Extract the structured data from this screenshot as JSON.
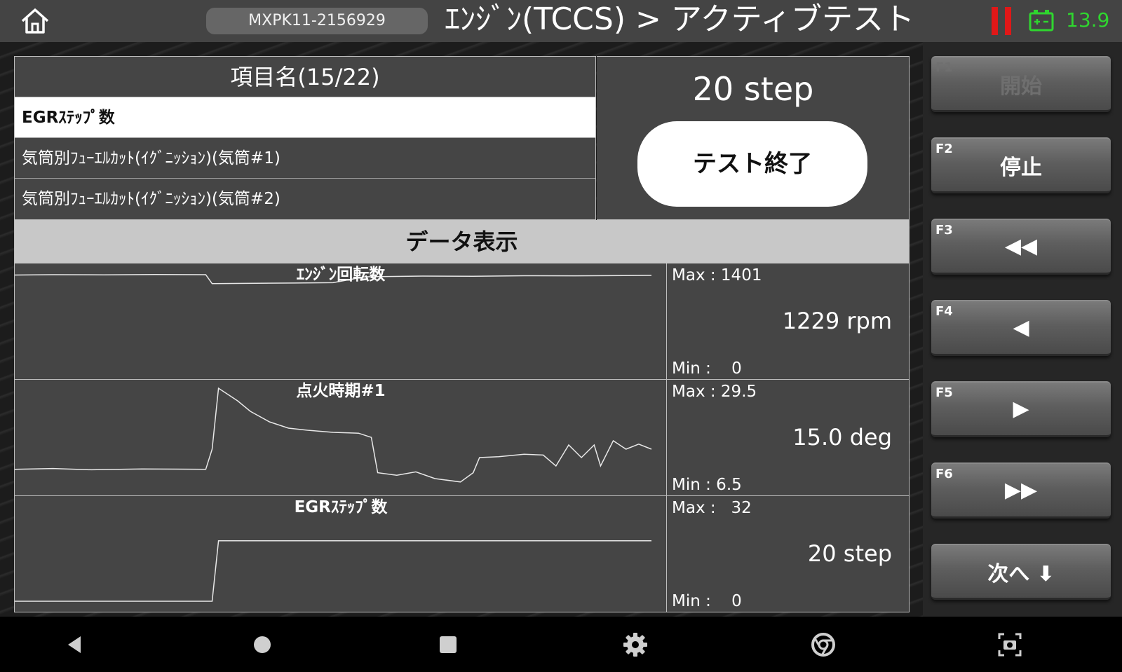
{
  "header": {
    "home_icon": "home-icon",
    "vehicle_id": "MXPK11-2156929",
    "title": "ｴﾝｼﾞﾝ(TCCS) > アクティブテスト",
    "status_icon": "pause-indicator-icon",
    "battery_icon": "battery-icon",
    "voltage": "13.9",
    "colors": {
      "status": "#e01818",
      "battery": "#2fd62f"
    }
  },
  "items": {
    "header": "項目名(15/22)",
    "rows": [
      {
        "label": "EGRｽﾃｯﾌﾟ数",
        "selected": true
      },
      {
        "label": "気筒別ﾌｭｰｴﾙｶｯﾄ(ｲｸﾞﾆｯｼｮﾝ)(気筒#1)",
        "selected": false
      },
      {
        "label": "気筒別ﾌｭｰｴﾙｶｯﾄ(ｲｸﾞﾆｯｼｮﾝ)(気筒#2)",
        "selected": false
      }
    ]
  },
  "test": {
    "current_value": "20 step",
    "end_button": "テスト終了"
  },
  "data_header": "データ表示",
  "graphs": [
    {
      "name": "ｴﾝｼﾞﾝ回転数",
      "max": "Max : 1401",
      "min": "Min :    0",
      "current": "1229 rpm",
      "y_range": [
        0,
        1401
      ],
      "trace": [
        [
          0,
          1355
        ],
        [
          0.06,
          1360
        ],
        [
          0.14,
          1358
        ],
        [
          0.22,
          1362
        ],
        [
          0.3,
          1360
        ],
        [
          0.31,
          1230
        ],
        [
          0.36,
          1235
        ],
        [
          0.44,
          1240
        ],
        [
          0.5,
          1245
        ],
        [
          0.55,
          1330
        ],
        [
          0.64,
          1340
        ],
        [
          0.72,
          1338
        ],
        [
          0.8,
          1345
        ],
        [
          0.88,
          1344
        ],
        [
          1.0,
          1350
        ]
      ]
    },
    {
      "name": "点火時期#1",
      "max": "Max : 29.5",
      "min": "Min : 6.5",
      "current": "15.0 deg",
      "y_range": [
        6.5,
        29.5
      ],
      "trace": [
        [
          0,
          10.2
        ],
        [
          0.06,
          10.4
        ],
        [
          0.12,
          10.1
        ],
        [
          0.2,
          10.3
        ],
        [
          0.3,
          10.2
        ],
        [
          0.31,
          15
        ],
        [
          0.32,
          29.5
        ],
        [
          0.35,
          26.5
        ],
        [
          0.37,
          24
        ],
        [
          0.4,
          21.5
        ],
        [
          0.43,
          20
        ],
        [
          0.46,
          19.5
        ],
        [
          0.5,
          19
        ],
        [
          0.54,
          18.8
        ],
        [
          0.56,
          17.8
        ],
        [
          0.57,
          9.4
        ],
        [
          0.6,
          8.8
        ],
        [
          0.63,
          9.6
        ],
        [
          0.66,
          8.0
        ],
        [
          0.7,
          7.2
        ],
        [
          0.72,
          9.4
        ],
        [
          0.73,
          13
        ],
        [
          0.76,
          13.2
        ],
        [
          0.8,
          13.8
        ],
        [
          0.83,
          13.6
        ],
        [
          0.85,
          11
        ],
        [
          0.87,
          16
        ],
        [
          0.89,
          13
        ],
        [
          0.91,
          16
        ],
        [
          0.92,
          11
        ],
        [
          0.94,
          17
        ],
        [
          0.96,
          15
        ],
        [
          0.98,
          16.2
        ],
        [
          1.0,
          15
        ]
      ]
    },
    {
      "name": "EGRｽﾃｯﾌﾟ数",
      "max": "Max :   32",
      "min": "Min :    0",
      "current": "20 step",
      "y_range": [
        0,
        32
      ],
      "trace": [
        [
          0,
          0
        ],
        [
          0.31,
          0
        ],
        [
          0.32,
          20
        ],
        [
          1.0,
          20
        ]
      ]
    }
  ],
  "function_keys": [
    {
      "key": "F1",
      "label": "開始",
      "enabled": false
    },
    {
      "key": "F2",
      "label": "停止",
      "enabled": true
    },
    {
      "key": "F3",
      "label": "◀◀",
      "icon": "rewind-icon",
      "enabled": true
    },
    {
      "key": "F4",
      "label": "◀",
      "icon": "step-back-icon",
      "enabled": true
    },
    {
      "key": "F5",
      "label": "▶",
      "icon": "step-forward-icon",
      "enabled": true
    },
    {
      "key": "F6",
      "label": "▶▶",
      "icon": "fast-forward-icon",
      "enabled": true
    },
    {
      "key": "",
      "label": "次へ ⬇",
      "enabled": true
    }
  ],
  "navbar": [
    "back-icon",
    "home-circle-icon",
    "recents-icon",
    "settings-gear-icon",
    "chrome-icon",
    "screenshot-icon"
  ]
}
